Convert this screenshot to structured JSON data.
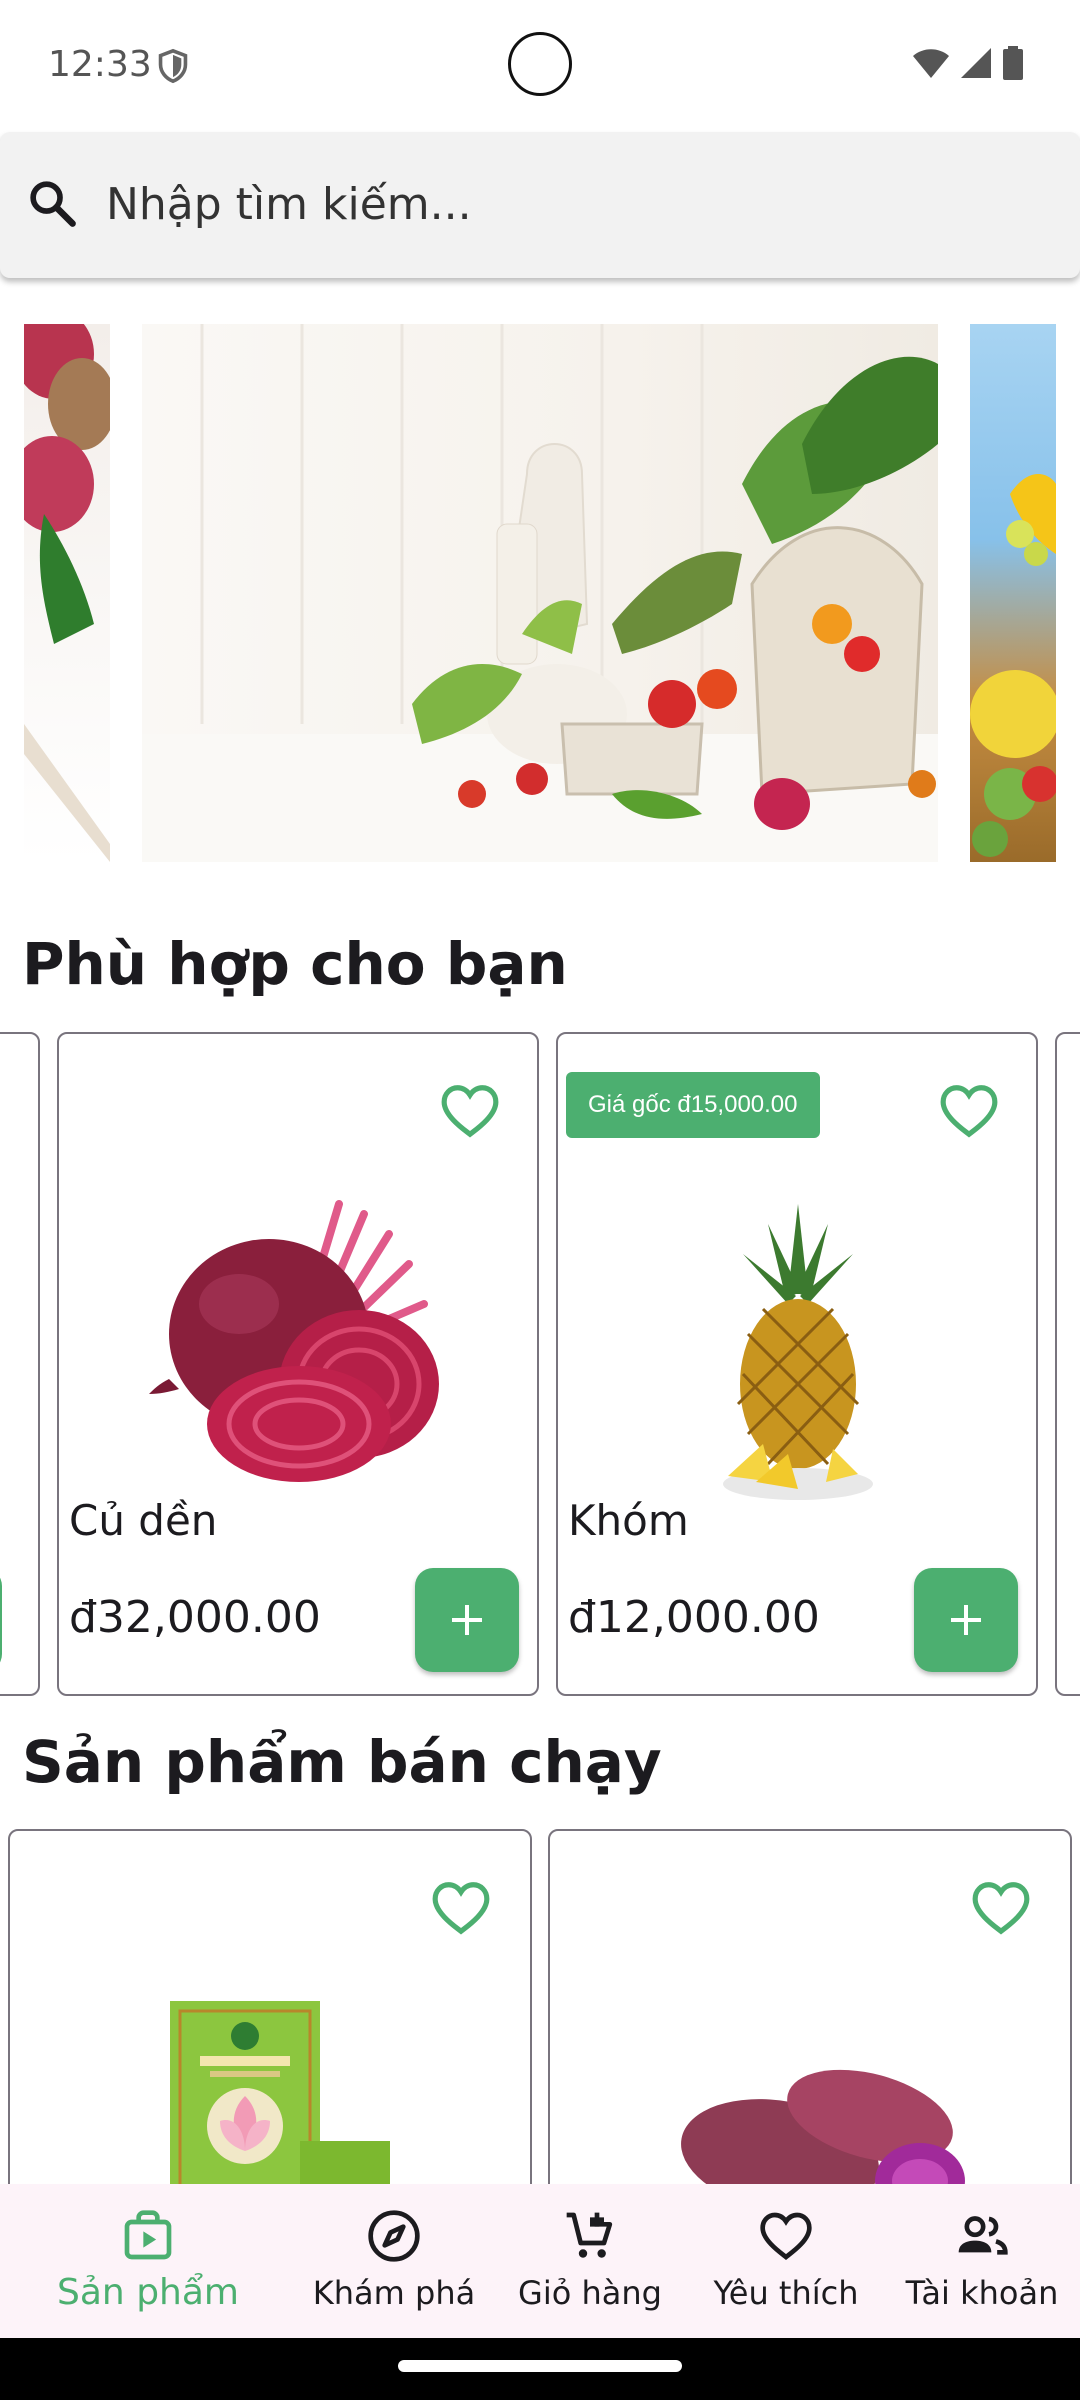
{
  "status_bar": {
    "time": "12:33"
  },
  "search": {
    "placeholder": "Nhập tìm kiếm..."
  },
  "sections": {
    "for_you": "Phù hợp cho bạn",
    "best_sellers": "Sản phẩm bán chạy"
  },
  "for_you_products": [
    {
      "name": "Củ dền",
      "price": "đ32,000.00"
    },
    {
      "name": "Khóm",
      "price": "đ12,000.00",
      "badge": "Giá gốc đ15,000.00"
    }
  ],
  "bottom_nav": [
    {
      "label": "Sản phẩm",
      "icon": "storefront-play-icon",
      "active": true
    },
    {
      "label": "Khám phá",
      "icon": "compass-icon"
    },
    {
      "label": "Giỏ hàng",
      "icon": "cart-add-icon"
    },
    {
      "label": "Yêu thích",
      "icon": "heart-icon"
    },
    {
      "label": "Tài khoản",
      "icon": "people-icon"
    }
  ],
  "colors": {
    "accent": "#4caf70",
    "nav_bg": "#fdf3f9",
    "card_border": "#79747e"
  }
}
